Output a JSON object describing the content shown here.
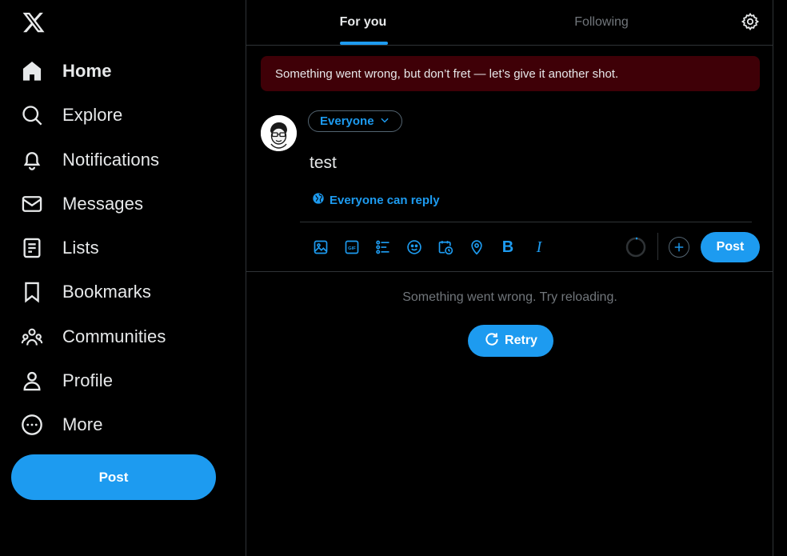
{
  "sidebar": {
    "logo_icon": "x-logo-icon",
    "items": [
      {
        "label": "Home",
        "icon": "home-icon"
      },
      {
        "label": "Explore",
        "icon": "search-icon"
      },
      {
        "label": "Notifications",
        "icon": "bell-icon"
      },
      {
        "label": "Messages",
        "icon": "envelope-icon"
      },
      {
        "label": "Lists",
        "icon": "list-icon"
      },
      {
        "label": "Bookmarks",
        "icon": "bookmark-icon"
      },
      {
        "label": "Communities",
        "icon": "people-icon"
      },
      {
        "label": "Profile",
        "icon": "person-icon"
      },
      {
        "label": "More",
        "icon": "more-circle-icon"
      }
    ],
    "post_label": "Post"
  },
  "header": {
    "tabs": [
      {
        "label": "For you",
        "active": true
      },
      {
        "label": "Following",
        "active": false
      }
    ]
  },
  "banner": {
    "message": "Something went wrong, but don’t fret — let’s give it another shot."
  },
  "composer": {
    "audience_label": "Everyone",
    "text": "test",
    "reply_setting": "Everyone can reply",
    "tools": [
      "image-icon",
      "gif-icon",
      "poll-icon",
      "emoji-icon",
      "schedule-icon",
      "location-icon",
      "bold-icon",
      "italic-icon"
    ],
    "bold_glyph": "B",
    "italic_glyph": "I",
    "post_label": "Post"
  },
  "feed": {
    "error_message": "Something went wrong. Try reloading.",
    "retry_label": "Retry"
  },
  "colors": {
    "accent": "#1d9bf0",
    "background": "#000000",
    "border": "#2f3336",
    "muted_text": "#71767b",
    "error_banner": "#3f0007"
  }
}
